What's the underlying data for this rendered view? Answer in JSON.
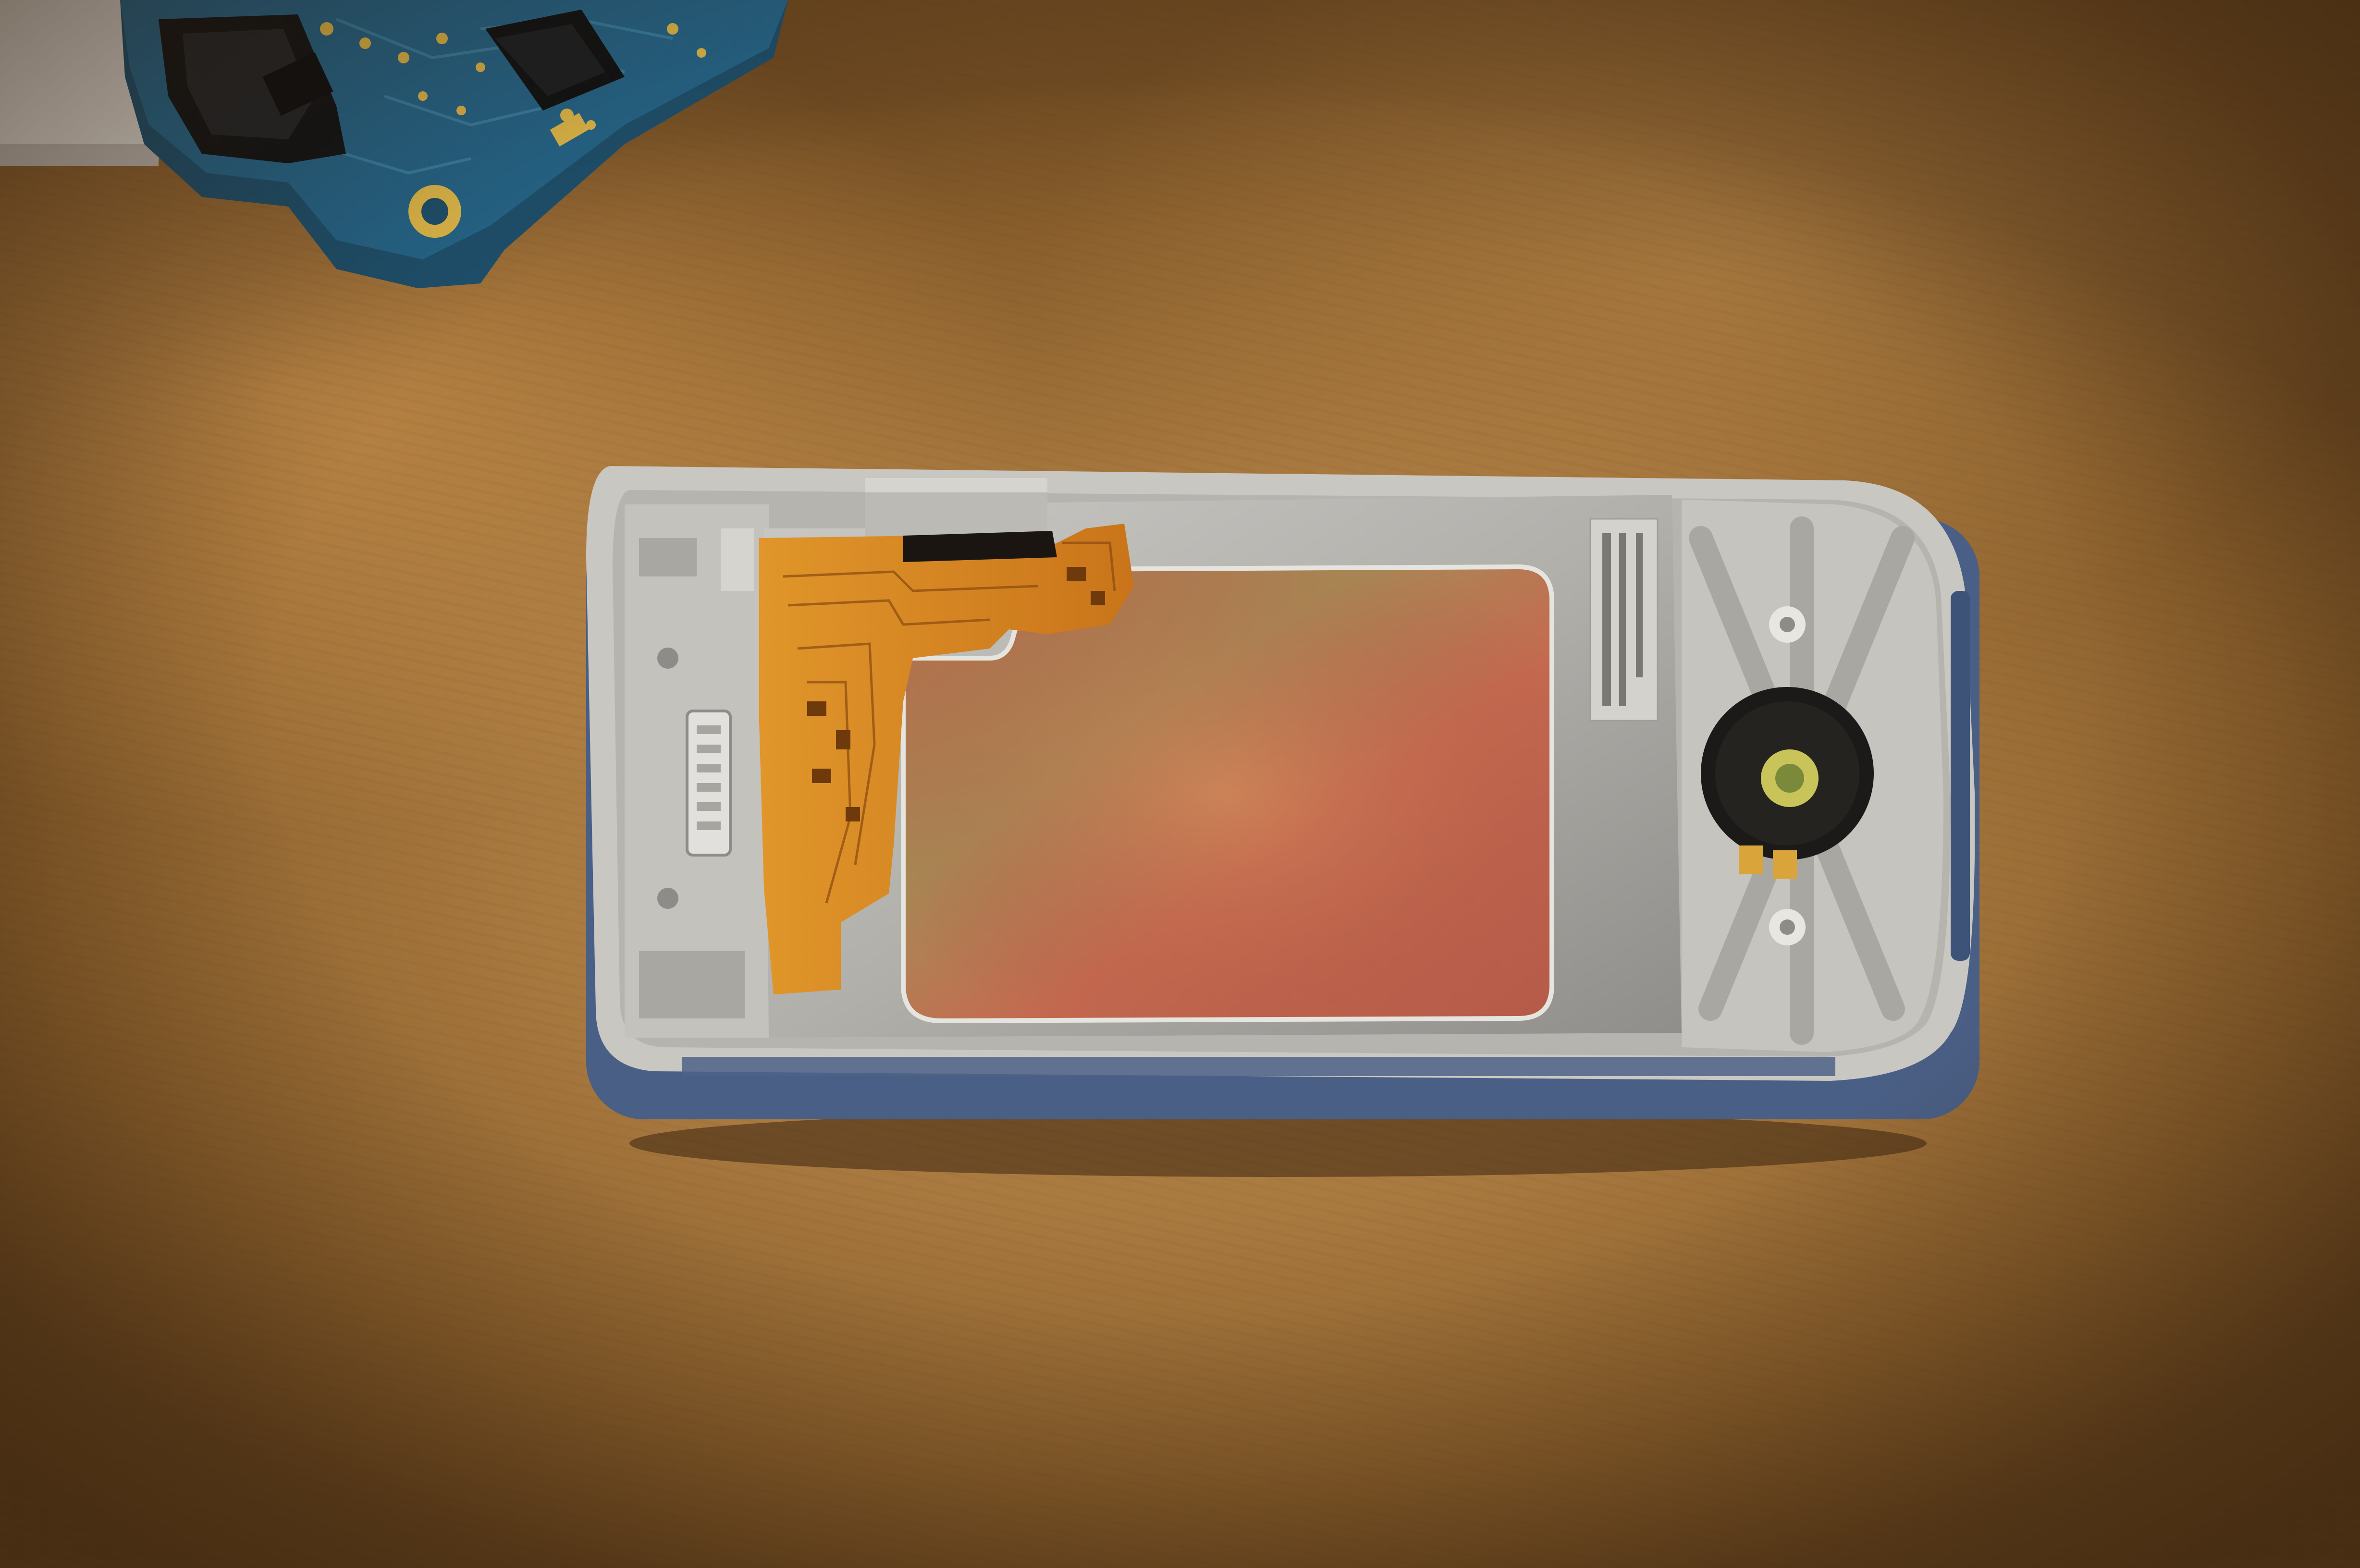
{
  "scene": {
    "background": "wooden-table",
    "colors": {
      "table": "#b98a4e",
      "frame": "#c9c7c2",
      "shield": "#b7b6b2",
      "flex": "#d9861f",
      "pcb": "#1d5a7a",
      "lcd_back": "#b46a4a",
      "accent_blue": "#4a5f85"
    },
    "objects": [
      {
        "name": "circuit-board",
        "description_icon": "pcb-icon"
      },
      {
        "name": "phone-frame",
        "description_icon": "phone-housing-icon"
      }
    ],
    "label_text": ""
  }
}
